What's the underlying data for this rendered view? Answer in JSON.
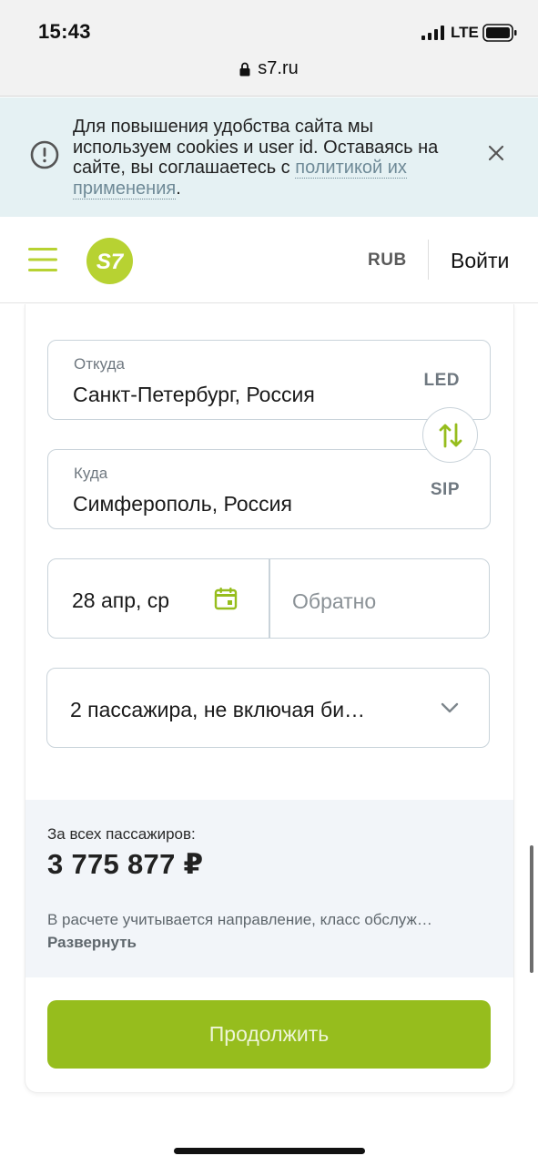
{
  "status_bar": {
    "time": "15:43",
    "network": "LTE",
    "icons": [
      "signal-icon",
      "battery-icon"
    ]
  },
  "browser": {
    "url": "s7.ru",
    "icons": [
      "lock-icon"
    ]
  },
  "cookie_banner": {
    "text": "Для повышения удобства сайта мы используем cookies и user id. Оставаясь на сайте, вы соглашаетесь с ",
    "link_text": "политикой их применения",
    "suffix": ".",
    "icons": [
      "info-icon",
      "close-icon"
    ],
    "background_color": "#e5f1f3",
    "link_color": "#6f8a97"
  },
  "header": {
    "logo_text": "S7",
    "currency": "RUB",
    "login_label": "Войти",
    "icons": [
      "burger-menu-icon"
    ],
    "brand_color": "#b7d232"
  },
  "search_form": {
    "from": {
      "label": "Откуда",
      "value": "Санкт-Петербург, Россия",
      "code": "LED"
    },
    "to": {
      "label": "Куда",
      "value": "Симферополь, Россия",
      "code": "SIP"
    },
    "swap_icon": "swap-arrows-icon",
    "date_depart": "28 апр, ср",
    "date_return_placeholder": "Обратно",
    "calendar_icon": "calendar-icon",
    "passengers": "2 пассажира, не включая би…",
    "passengers_icon": "chevron-down-icon"
  },
  "price": {
    "label": "За всех пассажиров:",
    "value": "3 775 877 ₽",
    "note": "В расчете учитывается направление, класс обслуж…",
    "expand_label": "Развернуть",
    "background_color": "#f2f5f9"
  },
  "continue_button": {
    "label": "Продолжить",
    "color": "#96bd1d"
  }
}
